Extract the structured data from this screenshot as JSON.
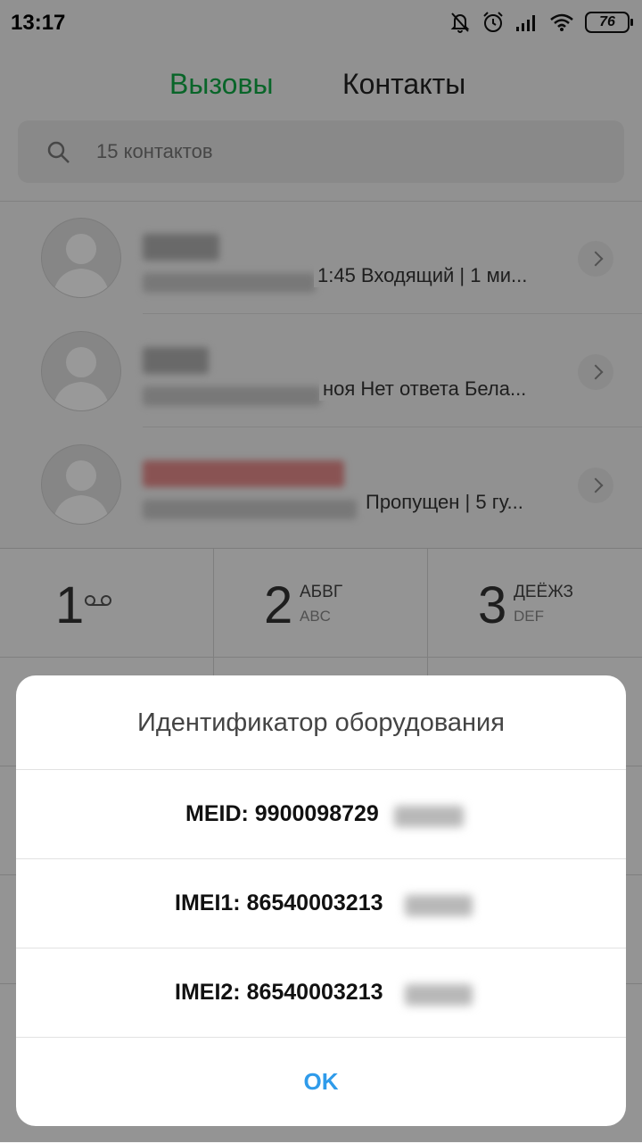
{
  "status_bar": {
    "time": "13:17",
    "battery": "76"
  },
  "tabs": [
    {
      "label": "Вызовы",
      "active": true,
      "color": "#10a845"
    },
    {
      "label": "Контакты",
      "active": false
    }
  ],
  "search": {
    "placeholder": "15 контактов"
  },
  "calls": [
    {
      "detail": "1:45 Входящий | 1 ми..."
    },
    {
      "detail": "ноя Нет ответа  Бела..."
    },
    {
      "detail": "Пропущен | 5 гу..."
    }
  ],
  "dialpad": [
    {
      "digit": "1",
      "letters": "",
      "latin": "",
      "icon": "voicemail-icon"
    },
    {
      "digit": "2",
      "letters": "АБВГ",
      "latin": "ABC"
    },
    {
      "digit": "3",
      "letters": "ДЕЁЖЗ",
      "latin": "DEF"
    }
  ],
  "dialog": {
    "title": "Идентификатор оборудования",
    "items": [
      {
        "label": "MEID: 9900098729"
      },
      {
        "label": "IMEI1: 86540003213"
      },
      {
        "label": "IMEI2: 86540003213"
      }
    ],
    "ok_label": "OK",
    "ok_color": "#2f9bea"
  }
}
